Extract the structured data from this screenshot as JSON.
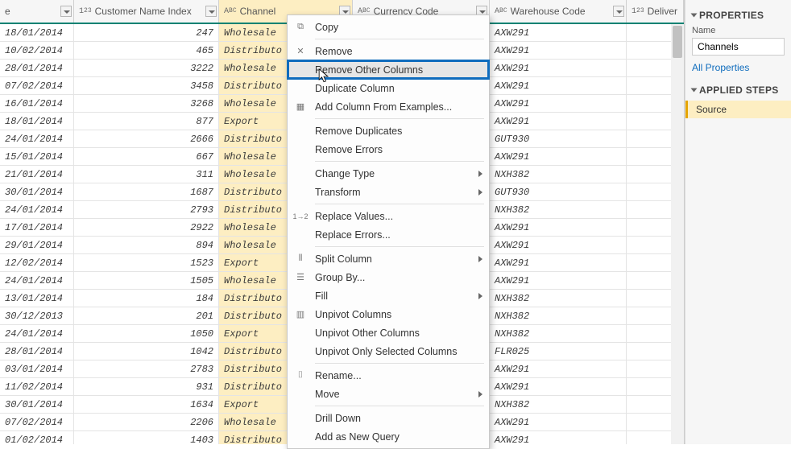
{
  "columns": {
    "date": {
      "label": ""
    },
    "index": {
      "label": "Customer Name Index"
    },
    "channel": {
      "label": "Channel"
    },
    "currency": {
      "label": "Currency Code"
    },
    "warehouse": {
      "label": "Warehouse Code"
    },
    "deliver": {
      "label": "Deliver"
    }
  },
  "rows": [
    {
      "d": "18/01/2014",
      "i": "247",
      "ch": "Wholesale",
      "w": "AXW291"
    },
    {
      "d": "10/02/2014",
      "i": "465",
      "ch": "Distributo",
      "w": "AXW291"
    },
    {
      "d": "28/01/2014",
      "i": "3222",
      "ch": "Wholesale",
      "w": "AXW291"
    },
    {
      "d": "07/02/2014",
      "i": "3458",
      "ch": "Distributo",
      "w": "AXW291"
    },
    {
      "d": "16/01/2014",
      "i": "3268",
      "ch": "Wholesale",
      "w": "AXW291"
    },
    {
      "d": "18/01/2014",
      "i": "877",
      "ch": "Export",
      "w": "AXW291"
    },
    {
      "d": "24/01/2014",
      "i": "2666",
      "ch": "Distributo",
      "w": "GUT930"
    },
    {
      "d": "15/01/2014",
      "i": "667",
      "ch": "Wholesale",
      "w": "AXW291"
    },
    {
      "d": "21/01/2014",
      "i": "311",
      "ch": "Wholesale",
      "w": "NXH382"
    },
    {
      "d": "30/01/2014",
      "i": "1687",
      "ch": "Distributo",
      "w": "GUT930"
    },
    {
      "d": "24/01/2014",
      "i": "2793",
      "ch": "Distributo",
      "w": "NXH382"
    },
    {
      "d": "17/01/2014",
      "i": "2922",
      "ch": "Wholesale",
      "w": "AXW291"
    },
    {
      "d": "29/01/2014",
      "i": "894",
      "ch": "Wholesale",
      "w": "AXW291"
    },
    {
      "d": "12/02/2014",
      "i": "1523",
      "ch": "Export",
      "w": "AXW291"
    },
    {
      "d": "24/01/2014",
      "i": "1505",
      "ch": "Wholesale",
      "w": "AXW291"
    },
    {
      "d": "13/01/2014",
      "i": "184",
      "ch": "Distributo",
      "w": "NXH382"
    },
    {
      "d": "30/12/2013",
      "i": "201",
      "ch": "Distributo",
      "w": "NXH382"
    },
    {
      "d": "24/01/2014",
      "i": "1050",
      "ch": "Export",
      "w": "NXH382"
    },
    {
      "d": "28/01/2014",
      "i": "1042",
      "ch": "Distributo",
      "w": "FLR025"
    },
    {
      "d": "03/01/2014",
      "i": "2783",
      "ch": "Distributo",
      "w": "AXW291"
    },
    {
      "d": "11/02/2014",
      "i": "931",
      "ch": "Distributo",
      "w": "AXW291"
    },
    {
      "d": "30/01/2014",
      "i": "1634",
      "ch": "Export",
      "w": "NXH382"
    },
    {
      "d": "07/02/2014",
      "i": "2206",
      "ch": "Wholesale",
      "w": "AXW291"
    },
    {
      "d": "01/02/2014",
      "i": "1403",
      "ch": "Distributo",
      "w": "AXW291"
    }
  ],
  "ctxmenu": {
    "copy": "Copy",
    "remove": "Remove",
    "remove_other": "Remove Other Columns",
    "duplicate": "Duplicate Column",
    "add_examples": "Add Column From Examples...",
    "remove_dup": "Remove Duplicates",
    "remove_err": "Remove Errors",
    "change_type": "Change Type",
    "transform": "Transform",
    "replace_vals": "Replace Values...",
    "replace_errs": "Replace Errors...",
    "split": "Split Column",
    "group": "Group By...",
    "fill": "Fill",
    "unpivot": "Unpivot Columns",
    "unpivot_other": "Unpivot Other Columns",
    "unpivot_sel": "Unpivot Only Selected Columns",
    "rename": "Rename...",
    "move": "Move",
    "drill": "Drill Down",
    "new_query": "Add as New Query"
  },
  "side": {
    "properties_head": "PROPERTIES",
    "name_label": "Name",
    "name_value": "Channels",
    "all_props": "All Properties",
    "steps_head": "APPLIED STEPS",
    "step_source": "Source"
  }
}
